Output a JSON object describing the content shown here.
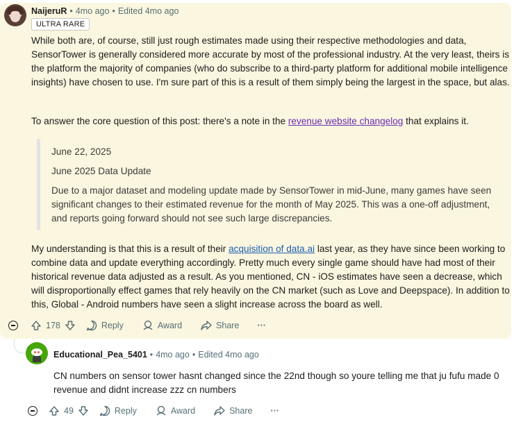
{
  "comment": {
    "username": "NaijeruR",
    "time": "4mo ago",
    "edited": "Edited 4mo ago",
    "flair": "ULTRA RARE",
    "para1": "While both are, of course, still just rough estimates made using their respective methodologies and data, SensorTower is generally considered more accurate by most of the professional industry. At the very least, theirs is the platform the majority of companies (who do subscribe to a third-party platform for additional mobile intelligence insights) have chosen to use. I'm sure part of this is a result of them simply being the largest in the space, but alas.",
    "para2_before": "To answer the core question of this post: there's a note in the ",
    "para2_link": "revenue website changelog",
    "para2_after": " that explains it.",
    "quote_date": "June 22, 2025",
    "quote_title": "June 2025 Data Update",
    "quote_body": "Due to a major dataset and modeling update made by SensorTower in mid-June, many games have seen significant changes to their estimated revenue for the month of May 2025. This was a one-off adjustment, and reports going forward should not see such large discrepancies.",
    "para3_before": "My understanding is that this is a result of their ",
    "para3_link": "acquisition of data.ai",
    "para3_after": " last year, as they have since been working to combine data and update everything accordingly. Pretty much every single game should have had most of their historical revenue data adjusted as a result. As you mentioned, CN - iOS estimates have seen a decrease, which will disproportionally effect games that rely heavily on the CN market (such as Love and Deepspace). In addition to this, Global - Android numbers have seen a slight increase across the board as well.",
    "votes": "178",
    "reply_label": "Reply",
    "award_label": "Award",
    "share_label": "Share",
    "more_label": "···"
  },
  "reply": {
    "username": "Educational_Pea_5401",
    "time": "4mo ago",
    "edited": "Edited 4mo ago",
    "text": "CN numbers on sensor tower hasnt changed since the 22nd though so youre telling me that ju fufu made 0 revenue and didnt increase zzz cn numbers",
    "votes": "49",
    "reply_label": "Reply",
    "award_label": "Award",
    "share_label": "Share",
    "more_label": "···"
  },
  "separator": "•",
  "colors": {
    "highlight_bg": "#fbf6df",
    "meta": "#576f76",
    "visited_link": "#6a2cb3",
    "link": "#1a5fb4",
    "reply_avatar": "#46a508"
  },
  "icons": [
    "collapse-icon",
    "upvote-icon",
    "downvote-icon",
    "reply-icon",
    "award-icon",
    "share-icon",
    "more-icon"
  ]
}
